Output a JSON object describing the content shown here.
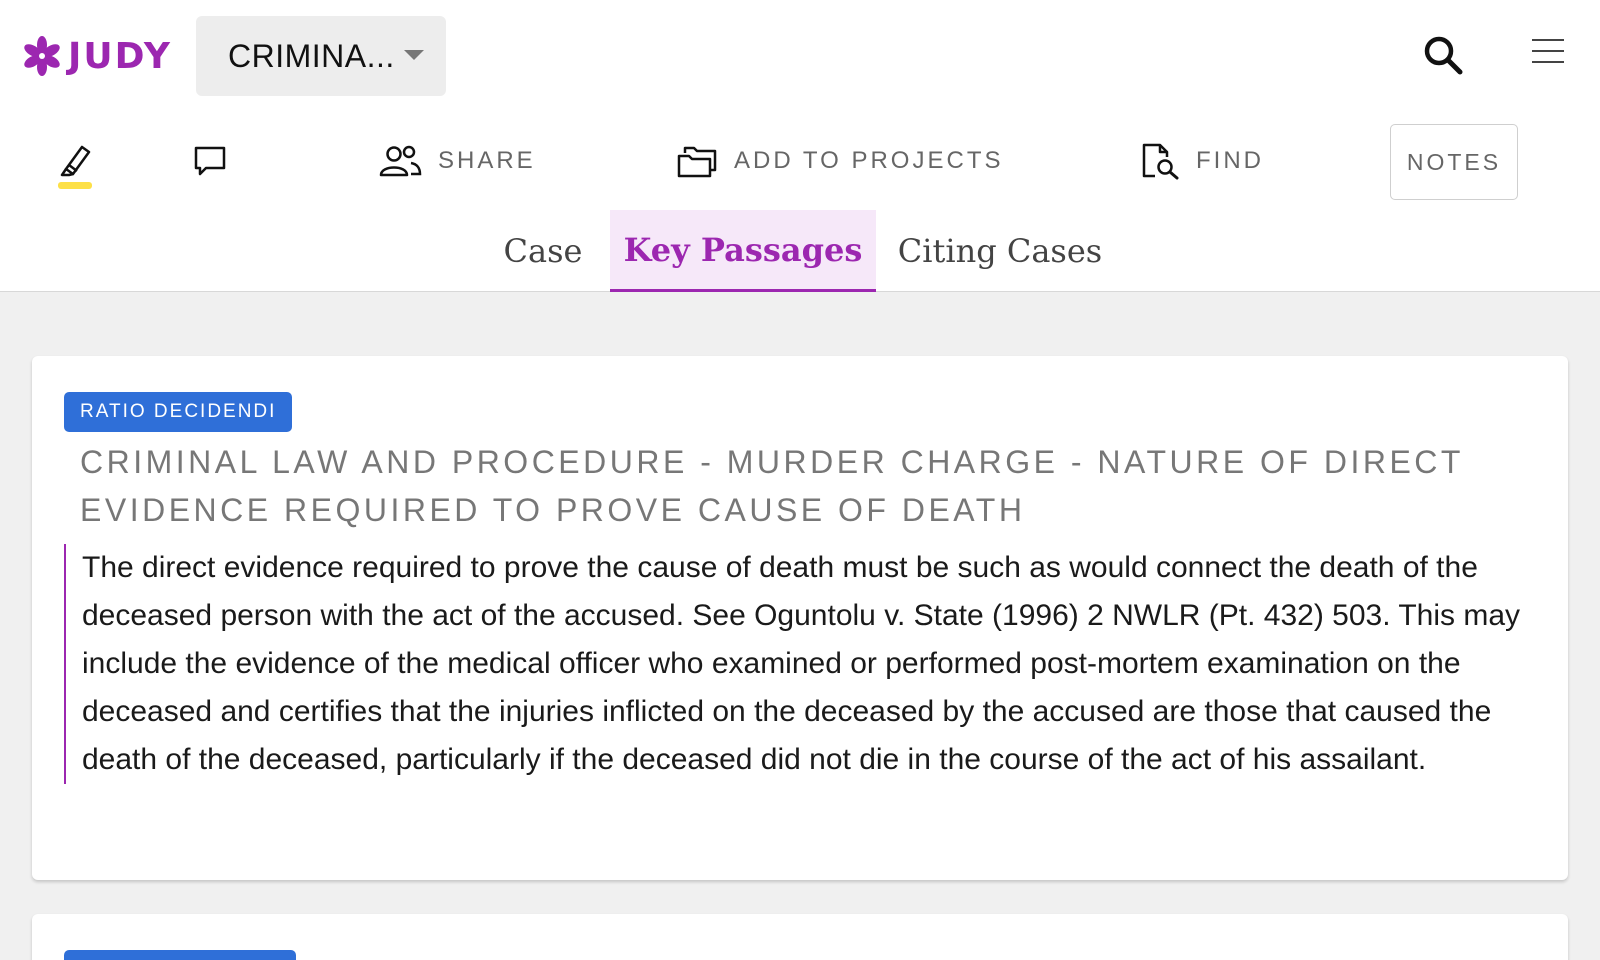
{
  "app": {
    "logo_text": "JUDY",
    "brand_color": "#9c27b0"
  },
  "case_selector": {
    "label": "CRIMINA..."
  },
  "header_icons": {
    "search": "search-icon",
    "menu": "hamburger-menu-icon"
  },
  "toolbar": {
    "highlight_icon": "highlighter-icon",
    "comment_icon": "comment-icon",
    "share_label": "SHARE",
    "add_to_projects_label": "ADD TO PROJECTS",
    "find_label": "FIND",
    "notes_label": "NOTES"
  },
  "tabs": [
    {
      "label": "Case",
      "active": false
    },
    {
      "label": "Key Passages",
      "active": true
    },
    {
      "label": "Citing Cases",
      "active": false
    }
  ],
  "passages": [
    {
      "badge": "RATIO DECIDENDI",
      "heading": "CRIMINAL LAW AND PROCEDURE - MURDER CHARGE - NATURE OF DIRECT EVIDENCE REQUIRED TO PROVE CAUSE OF DEATH",
      "text": "The direct evidence required to prove the cause of death must be such as would connect the death of the deceased person with the act of the accused. See Oguntolu v. State (1996) 2 NWLR (Pt. 432) 503. This may include the evidence of the medical officer who examined or performed post-mortem examination on the deceased and certifies that the injuries inflicted on the deceased by the accused are those that caused the death of the deceased, particularly if the deceased did not die in the course of the act of his assailant."
    }
  ],
  "colors": {
    "badge": "#2f6fd8",
    "highlight": "#fde047",
    "active_tab_bg": "#f6e8f9"
  }
}
